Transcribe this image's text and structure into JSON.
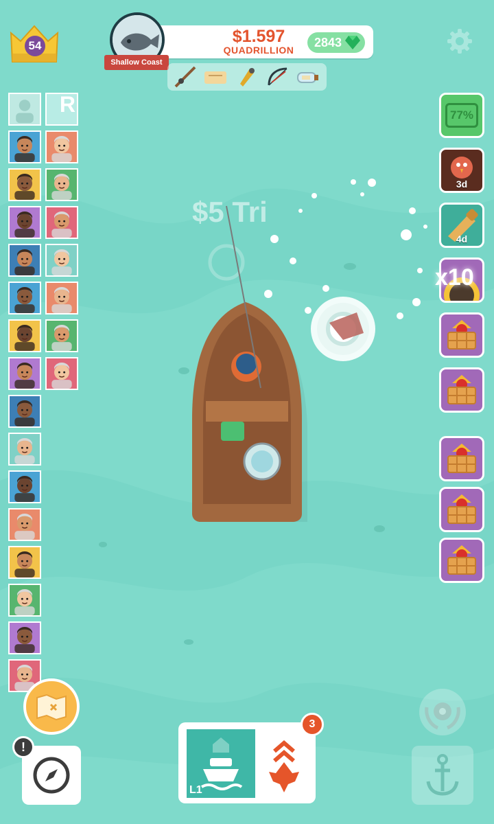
{
  "player": {
    "level": "54"
  },
  "area": {
    "name": "Shallow Coast",
    "portrait_icon": "fish-icon"
  },
  "currency": {
    "amount": "$1.597",
    "unit": "QUADRILLION",
    "gems": "2843"
  },
  "tools": [
    {
      "icon": "fishing-rod-icon"
    },
    {
      "icon": "map-scroll-icon"
    },
    {
      "icon": "lure-icon"
    },
    {
      "icon": "bow-icon"
    },
    {
      "icon": "bottle-message-icon"
    }
  ],
  "crew": {
    "locked_letter": "R",
    "portraits": [
      "crew-1",
      "crew-2",
      "crew-3",
      "crew-4",
      "crew-5",
      "crew-6",
      "crew-7",
      "crew-8",
      "crew-9",
      "crew-10",
      "crew-11",
      "crew-12",
      "crew-13",
      "crew-14",
      "crew-15",
      "crew-16",
      "crew-17",
      "crew-18",
      "crew-19",
      "crew-20",
      "crew-21",
      "crew-22",
      "crew-23"
    ]
  },
  "boosts": {
    "boost_percent": "77%",
    "turkey_timer": "3d",
    "spyglass_timer": "4d",
    "multiplier": "x10"
  },
  "catch_popup": "$5 Tri",
  "boat": {
    "level_label": "L1"
  },
  "upgrades": {
    "badge_count": "3"
  },
  "alert": {
    "symbol": "!"
  },
  "colors": {
    "water": "#7fdacb",
    "money": "#e3542e",
    "gem_pill": "#86e0a3",
    "boat_tab": "#3fb7a7",
    "badge": "#e5552a",
    "basket_bg": "#a169b8"
  }
}
